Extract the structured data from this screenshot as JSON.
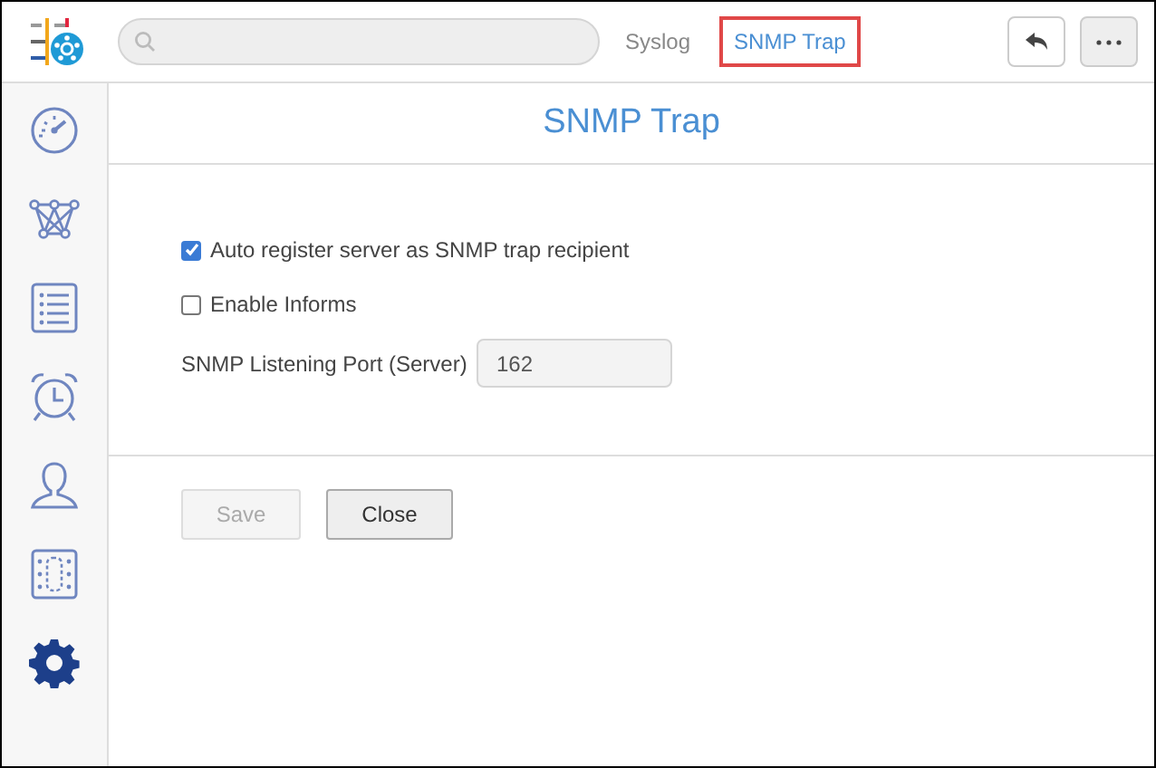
{
  "tabs": [
    {
      "label": "Syslog",
      "selected": false
    },
    {
      "label": "SNMP Trap",
      "selected": true
    }
  ],
  "sidebar": {
    "items": [
      {
        "kind": "gauge",
        "selected": false
      },
      {
        "kind": "network",
        "selected": false
      },
      {
        "kind": "list",
        "selected": false
      },
      {
        "kind": "alarm",
        "selected": false
      },
      {
        "kind": "user",
        "selected": false
      },
      {
        "kind": "panel",
        "selected": false
      },
      {
        "kind": "gear",
        "selected": true
      }
    ]
  },
  "title": "SNMP Trap",
  "options": [
    {
      "label": "Auto register server as SNMP trap recipient",
      "checked": true
    },
    {
      "label": "Enable Informs",
      "checked": false
    }
  ],
  "port": {
    "label": "SNMP Listening Port (Server)",
    "value": "162"
  },
  "buttons": [
    {
      "label": "Save",
      "disabled": true
    },
    {
      "label": "Close",
      "disabled": false
    }
  ]
}
